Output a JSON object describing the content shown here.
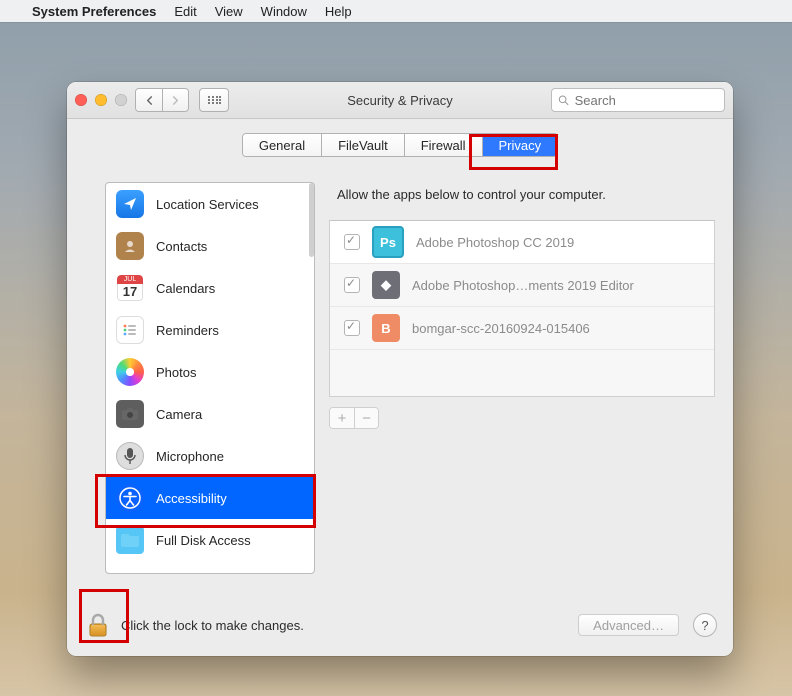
{
  "menubar": {
    "app": "System Preferences",
    "items": [
      "Edit",
      "View",
      "Window",
      "Help"
    ]
  },
  "window": {
    "title": "Security & Privacy",
    "search_placeholder": "Search",
    "tabs": [
      {
        "label": "General",
        "active": false
      },
      {
        "label": "FileVault",
        "active": false
      },
      {
        "label": "Firewall",
        "active": false
      },
      {
        "label": "Privacy",
        "active": true
      }
    ],
    "sidebar": {
      "items": [
        {
          "label": "Location Services",
          "icon_class": "sb-location",
          "glyph": "➤",
          "selected": false
        },
        {
          "label": "Contacts",
          "icon_class": "sb-contacts",
          "glyph": "",
          "selected": false
        },
        {
          "label": "Calendars",
          "icon_class": "sb-cal",
          "glyph": "",
          "selected": false,
          "cal_top": "JUL",
          "cal_num": "17"
        },
        {
          "label": "Reminders",
          "icon_class": "sb-reminders",
          "glyph": "≣",
          "selected": false
        },
        {
          "label": "Photos",
          "icon_class": "sb-photos",
          "glyph": "",
          "selected": false
        },
        {
          "label": "Camera",
          "icon_class": "sb-camera",
          "glyph": "◎",
          "selected": false
        },
        {
          "label": "Microphone",
          "icon_class": "sb-mic",
          "glyph": "🎙",
          "selected": false
        },
        {
          "label": "Accessibility",
          "icon_class": "sb-access",
          "glyph": "",
          "selected": true
        },
        {
          "label": "Full Disk Access",
          "icon_class": "sb-fda",
          "glyph": "▣",
          "selected": false
        }
      ]
    },
    "instruction": "Allow the apps below to control your computer.",
    "apps": [
      {
        "name": "Adobe Photoshop CC 2019",
        "icon_bg": "#3cc0dc",
        "icon_text": "Ps",
        "checked": true
      },
      {
        "name": "Adobe Photoshop…ments 2019 Editor",
        "icon_bg": "#6e6e77",
        "icon_text": "◆",
        "checked": true
      },
      {
        "name": "bomgar-scc-20160924-015406",
        "icon_bg": "#f08c65",
        "icon_text": "B",
        "checked": true
      }
    ],
    "bottom": {
      "lock_text": "Click the lock to make changes.",
      "advanced": "Advanced…"
    }
  }
}
